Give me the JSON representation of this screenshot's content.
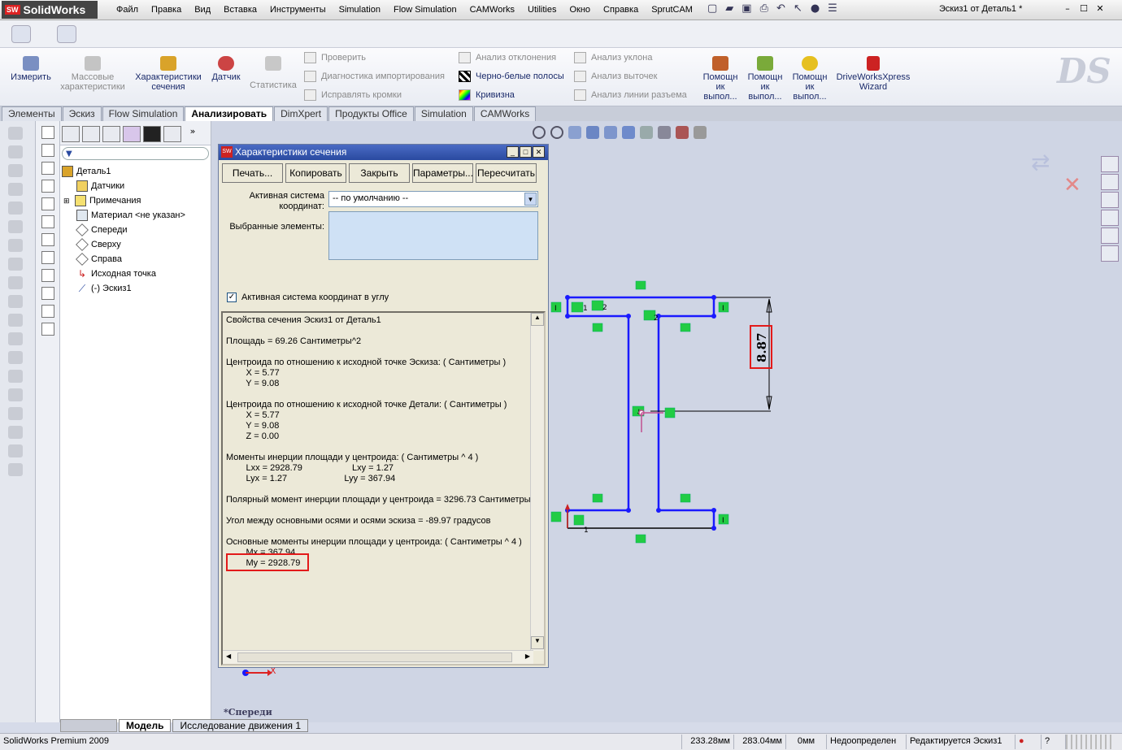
{
  "app": {
    "logo_text": "SolidWorks",
    "window_title": "Эскиз1 от Деталь1 *"
  },
  "menu": [
    "Файл",
    "Правка",
    "Вид",
    "Вставка",
    "Инструменты",
    "Simulation",
    "Flow Simulation",
    "CAMWorks",
    "Utilities",
    "Окно",
    "Справка",
    "SprutCAM"
  ],
  "command_manager": {
    "buttons": [
      {
        "label": "Измерить"
      },
      {
        "label": "Массовые\nхарактеристики"
      },
      {
        "label": "Характеристики\nсечения"
      },
      {
        "label": "Датчик"
      },
      {
        "label": "Статистика"
      },
      {
        "label": "Помощн\nик\nвыпол..."
      },
      {
        "label": "Помощн\nик\nвыпол..."
      },
      {
        "label": "Помощн\nик\nвыпол..."
      },
      {
        "label": "DriveWorksXpress\nWizard"
      }
    ],
    "small": [
      {
        "label": "Проверить"
      },
      {
        "label": "Диагностика импортирования"
      },
      {
        "label": "Исправлять кромки"
      },
      {
        "label": "Анализ отклонения"
      },
      {
        "label": "Черно-белые полосы"
      },
      {
        "label": "Кривизна"
      },
      {
        "label": "Анализ уклона"
      },
      {
        "label": "Анализ выточек"
      },
      {
        "label": "Анализ линии разъема"
      }
    ]
  },
  "tabs": [
    "Элементы",
    "Эскиз",
    "Flow Simulation",
    "Анализировать",
    "DimXpert",
    "Продукты Office",
    "Simulation",
    "CAMWorks"
  ],
  "feature_tree": {
    "root": "Деталь1",
    "items": [
      "Датчики",
      "Примечания",
      "Материал <не указан>",
      "Спереди",
      "Сверху",
      "Справа",
      "Исходная точка",
      "(-) Эскиз1"
    ]
  },
  "dialog": {
    "title": "Характеристики сечения",
    "buttons": [
      "Печать...",
      "Копировать",
      "Закрыть",
      "Параметры...",
      "Пересчитать"
    ],
    "coord_label": "Активная система\nкоординат:",
    "coord_value": "-- по умолчанию --",
    "selected_label": "Выбранные элементы:",
    "checkbox_label": "Активная система координат в углу",
    "results": [
      "Свойства сечения Эскиз1 от Деталь1",
      "",
      "Площадь = 69.26 Сантиметры^2",
      "",
      "Центроида по отношению к исходной точке Эскиза: ( Сантиметры )",
      "        X = 5.77",
      "        Y = 9.08",
      "",
      "Центроида по отношению к исходной точке Детали: ( Сантиметры )",
      "        X = 5.77",
      "        Y = 9.08",
      "        Z = 0.00",
      "",
      "Моменты инерции площади у центроида: ( Сантиметры ^ 4 )",
      "        Lxx = 2928.79                    Lxy = 1.27",
      "        Lyx = 1.27                       Lyy = 367.94",
      "",
      "Полярный момент инерции площади у центроида = 3296.73 Сантиметры",
      "",
      "Угол между основными осями и осями эскиза = -89.97 градусов",
      "",
      "Основные моменты инерции площади у центроида: ( Сантиметры ^ 4 )",
      "        Mx = 367.94",
      "        My = 2928.79"
    ]
  },
  "drawing": {
    "dimension": "8.87",
    "view_label": "*Спереди",
    "axis_x": "X"
  },
  "bottom_tabs": [
    "Модель",
    "Исследование движения 1"
  ],
  "status": {
    "product": "SolidWorks Premium 2009",
    "x": "233.28мм",
    "y": "283.04мм",
    "z": "0мм",
    "state": "Недоопределен",
    "editing": "Редактируется Эскиз1"
  },
  "colors": {
    "sketch_line": "#1a1aff",
    "relation_box": "#22cc44",
    "highlight": "#e31a1a"
  }
}
